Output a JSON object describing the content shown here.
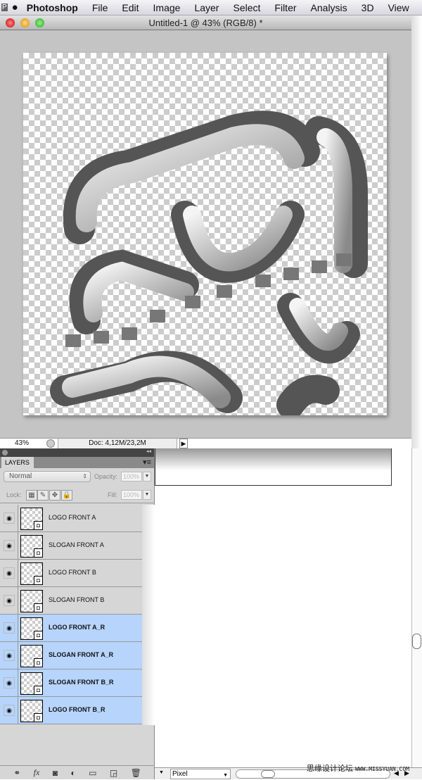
{
  "menubar": {
    "app": "Photoshop",
    "items": [
      "File",
      "Edit",
      "Image",
      "Layer",
      "Select",
      "Filter",
      "Analysis",
      "3D",
      "View"
    ]
  },
  "window": {
    "title": "Untitled-1 @ 43% (RGB/8) *"
  },
  "status": {
    "zoom": "43%",
    "doc": "Doc: 4,12M/23,2M"
  },
  "layers_panel": {
    "tab": "LAYERS",
    "blend_mode": "Normal",
    "opacity_label": "Opacity:",
    "opacity": "100%",
    "lock_label": "Lock:",
    "fill_label": "Fill:",
    "fill": "100%",
    "layers": [
      {
        "name": "LOGO FRONT A",
        "selected": false,
        "visible": true
      },
      {
        "name": "SLOGAN FRONT A",
        "selected": false,
        "visible": true
      },
      {
        "name": "LOGO FRONT B",
        "selected": false,
        "visible": true
      },
      {
        "name": "SLOGAN FRONT B",
        "selected": false,
        "visible": true
      },
      {
        "name": "LOGO FRONT A_R",
        "selected": true,
        "visible": true
      },
      {
        "name": "SLOGAN FRONT A_R",
        "selected": true,
        "visible": true
      },
      {
        "name": "SLOGAN FRONT B_R",
        "selected": true,
        "visible": true
      },
      {
        "name": "LOGO FRONT B_R",
        "selected": true,
        "visible": true
      }
    ],
    "selection_color": "#b6d4fc"
  },
  "bottom": {
    "unit": "Pixel"
  },
  "watermark": {
    "cn": "思缘设计论坛",
    "url": "WWW.MISSYUAN.COM"
  }
}
